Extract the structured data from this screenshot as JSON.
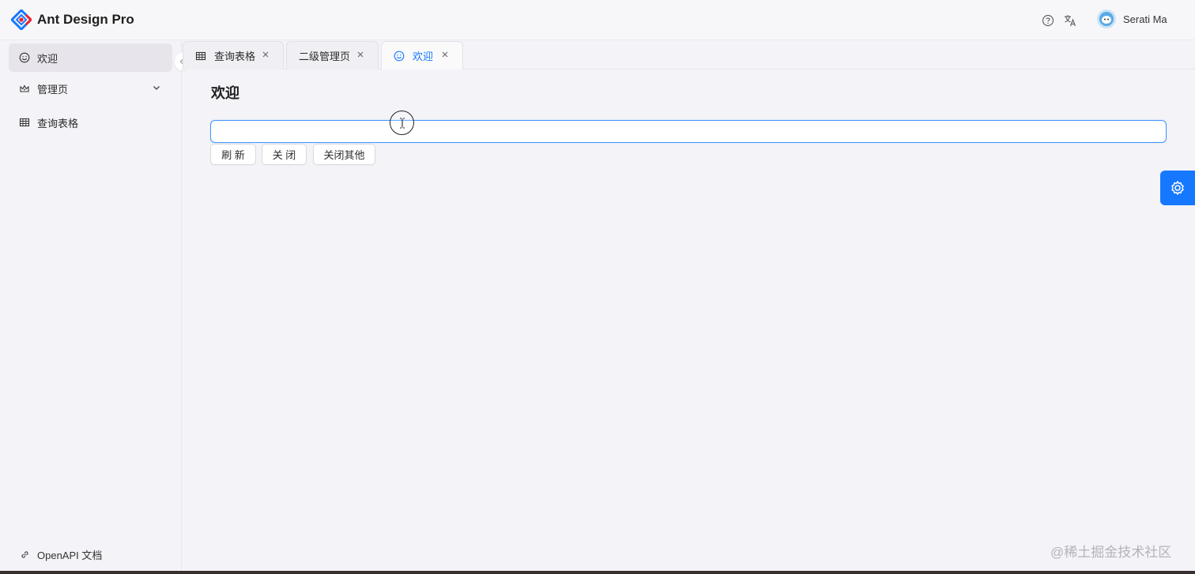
{
  "app": {
    "title": "Ant Design Pro",
    "brand_color": "#1677ff"
  },
  "header": {
    "help_icon": "question-circle-icon",
    "lang_icon": "translation-icon",
    "user_name": "Serati Ma"
  },
  "sidebar": {
    "items": [
      {
        "label": "欢迎",
        "icon": "smile-icon",
        "active": true
      },
      {
        "label": "管理页",
        "icon": "crown-icon",
        "has_submenu": true
      },
      {
        "label": "查询表格",
        "icon": "table-icon"
      }
    ],
    "footer_link": "OpenAPI 文档"
  },
  "tabs": [
    {
      "label": "查询表格",
      "icon": "table-icon"
    },
    {
      "label": "二级管理页"
    },
    {
      "label": "欢迎",
      "icon": "smile-icon",
      "active": true
    }
  ],
  "main": {
    "page_title": "欢迎",
    "input_value": "",
    "buttons": {
      "refresh": "刷 新",
      "close": "关 闭",
      "close_others": "关闭其他"
    }
  },
  "watermark": "@稀土掘金技术社区"
}
